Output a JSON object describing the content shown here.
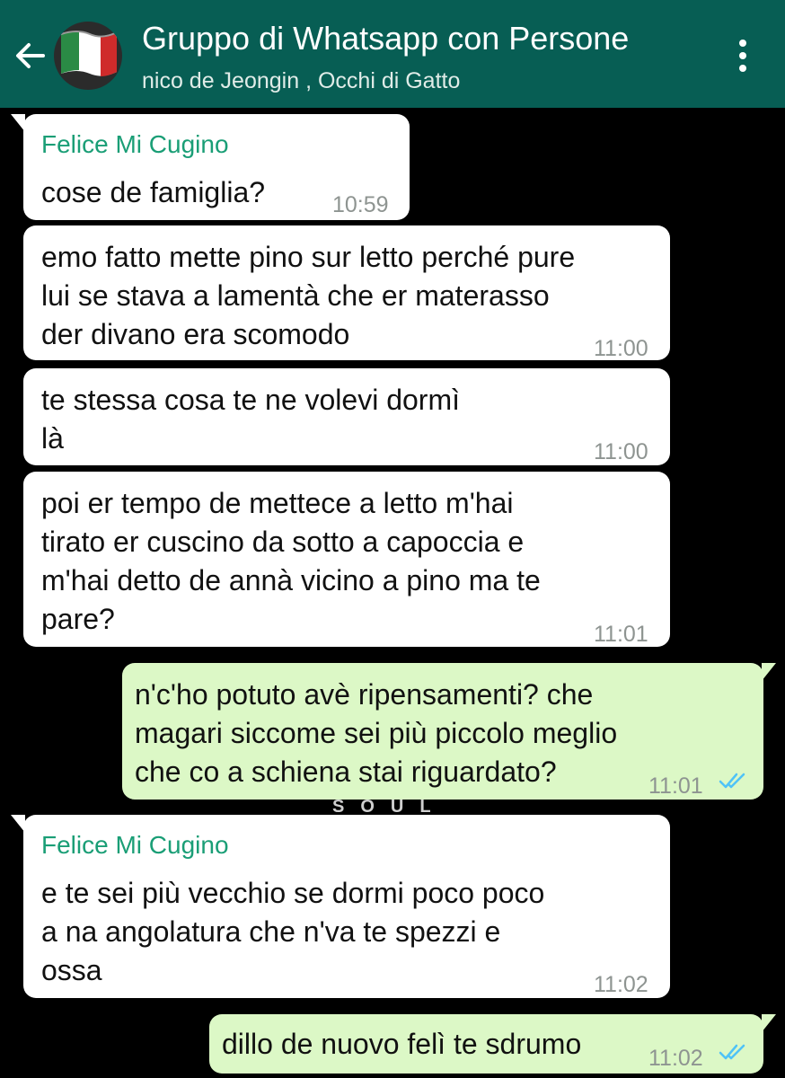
{
  "header": {
    "title": "Gruppo di Whatsapp con Persone",
    "subtitle": "nico de Jeongin , Occhi di Gatto",
    "back_icon": "arrow-left-icon",
    "menu_icon": "kebab-menu-icon",
    "header_color": "#075e54"
  },
  "messages": [
    {
      "sender": "Felice Mi Cugino",
      "lines": [
        "cose de famiglia?"
      ],
      "time": "10:59",
      "direction": "incoming"
    },
    {
      "lines": [
        "emo fatto mette pino sur letto perché pure",
        "lui se stava a lamentà che er materasso",
        "der divano era scomodo"
      ],
      "time": "11:00",
      "direction": "incoming"
    },
    {
      "lines": [
        "te stessa cosa te ne volevi dormì",
        "là"
      ],
      "time": "11:00",
      "direction": "incoming"
    },
    {
      "lines": [
        "poi er tempo de mettece a letto m'hai",
        "tirato er cuscino da sotto a capoccia e",
        "m'hai detto de annà vicino a pino ma te",
        "pare?"
      ],
      "time": "11:01",
      "direction": "incoming"
    },
    {
      "lines": [
        "n'c'ho potuto avè ripensamenti? che",
        "magari siccome sei più piccolo meglio",
        "che co a schiena stai riguardato?"
      ],
      "time": "11:01",
      "direction": "outgoing",
      "status": "read"
    },
    {
      "sender": "Felice Mi Cugino",
      "lines": [
        "e te sei più vecchio se dormi poco poco",
        "a na angolatura che n'va te spezzi e",
        "ossa"
      ],
      "time": "11:02",
      "direction": "incoming"
    },
    {
      "lines": [
        "dillo de nuovo felì te sdrumo"
      ],
      "time": "11:02",
      "direction": "outgoing",
      "status": "read"
    }
  ],
  "overlay_text": "SOUL",
  "colors": {
    "incoming": "#ffffff",
    "outgoing": "#dcf8c6",
    "sender": "#1a9e76",
    "ticks": "#4fc3f7",
    "background": "#000000"
  }
}
